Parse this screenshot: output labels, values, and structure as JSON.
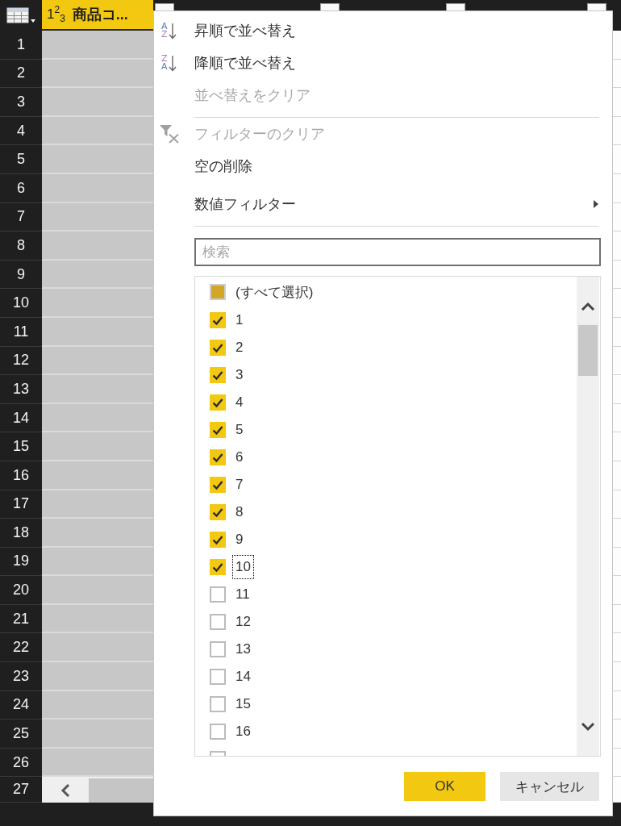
{
  "header": {
    "columns": [
      {
        "type_label": "1$^{2}$$_{3}$",
        "title": "商品コ...",
        "selected": true
      },
      {
        "selected": false
      },
      {
        "selected": false
      },
      {
        "selected": false
      }
    ]
  },
  "row_numbers": [
    "1",
    "2",
    "3",
    "4",
    "5",
    "6",
    "7",
    "8",
    "9",
    "10",
    "11",
    "12",
    "13",
    "14",
    "15",
    "16",
    "17",
    "18",
    "19",
    "20",
    "21",
    "22",
    "23",
    "24",
    "25",
    "26",
    "27"
  ],
  "menu": {
    "items": [
      {
        "kind": "sort-ascending",
        "glyphs": [
          "A",
          "Z"
        ],
        "label": "昇順で並べ替え",
        "disabled": false
      },
      {
        "kind": "sort-descending",
        "glyphs": [
          "Z",
          "A"
        ],
        "label": "降順で並べ替え",
        "disabled": false
      },
      {
        "kind": "plain",
        "label": "並べ替えをクリア",
        "disabled": true
      },
      {
        "kind": "separator"
      },
      {
        "kind": "clear-filter",
        "label": "フィルターのクリア",
        "disabled": true
      },
      {
        "kind": "plain",
        "label": "空の削除",
        "disabled": false
      },
      {
        "kind": "submenu",
        "label": "数値フィルター",
        "disabled": false
      },
      {
        "kind": "separator"
      }
    ],
    "search": {
      "placeholder": "検索"
    },
    "value_list": {
      "select_all": {
        "label": "(すべて選択)",
        "checked": false,
        "mixed": true
      },
      "values": [
        {
          "label": "1",
          "checked": true,
          "focused": false
        },
        {
          "label": "2",
          "checked": true,
          "focused": false
        },
        {
          "label": "3",
          "checked": true,
          "focused": false
        },
        {
          "label": "4",
          "checked": true,
          "focused": false
        },
        {
          "label": "5",
          "checked": true,
          "focused": false
        },
        {
          "label": "6",
          "checked": true,
          "focused": false
        },
        {
          "label": "7",
          "checked": true,
          "focused": false
        },
        {
          "label": "8",
          "checked": true,
          "focused": false
        },
        {
          "label": "9",
          "checked": true,
          "focused": false
        },
        {
          "label": "10",
          "checked": true,
          "focused": true
        },
        {
          "label": "11",
          "checked": false,
          "focused": false
        },
        {
          "label": "12",
          "checked": false,
          "focused": false
        },
        {
          "label": "13",
          "checked": false,
          "focused": false
        },
        {
          "label": "14",
          "checked": false,
          "focused": false
        },
        {
          "label": "15",
          "checked": false,
          "focused": false
        },
        {
          "label": "16",
          "checked": false,
          "focused": false
        },
        {
          "checked": false,
          "focused": false
        }
      ]
    },
    "buttons": [
      {
        "label": "OK",
        "kind": "primary"
      },
      {
        "label": "キャンセル",
        "kind": "secondary"
      }
    ]
  }
}
